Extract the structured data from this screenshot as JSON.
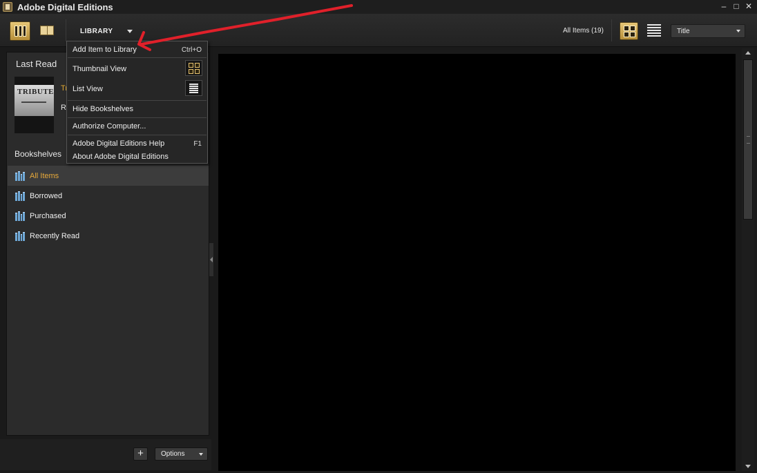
{
  "window": {
    "title": "Adobe Digital Editions",
    "controls": [
      "–",
      "□",
      "✕"
    ]
  },
  "toolbar": {
    "library_label": "LIBRARY",
    "all_items_label": "All Items  (19)",
    "sort_value": "Title",
    "accent_color": "#c9a24e"
  },
  "menu": {
    "items": [
      {
        "label": "Add Item to Library",
        "shortcut": "Ctrl+O"
      },
      {
        "label": "Thumbnail View"
      },
      {
        "label": "List View"
      },
      {
        "label": "Hide Bookshelves"
      },
      {
        "label": "Authorize Computer..."
      },
      {
        "label": "Adobe Digital Editions Help",
        "shortcut": "F1"
      },
      {
        "label": "About Adobe Digital Editions"
      }
    ]
  },
  "left_panel": {
    "last_read_title": "Last Read",
    "book": {
      "cover_text": "TRIBUTE",
      "title_partial": "Tr",
      "author_partial": "Ro"
    },
    "bookshelves_title": "Bookshelves",
    "shelves": [
      {
        "label": "All Items",
        "selected": true
      },
      {
        "label": "Borrowed"
      },
      {
        "label": "Purchased"
      },
      {
        "label": "Recently Read"
      }
    ]
  },
  "footer": {
    "add_label": "+",
    "options_label": "Options"
  },
  "annotation": {
    "color": "#e0202a"
  }
}
